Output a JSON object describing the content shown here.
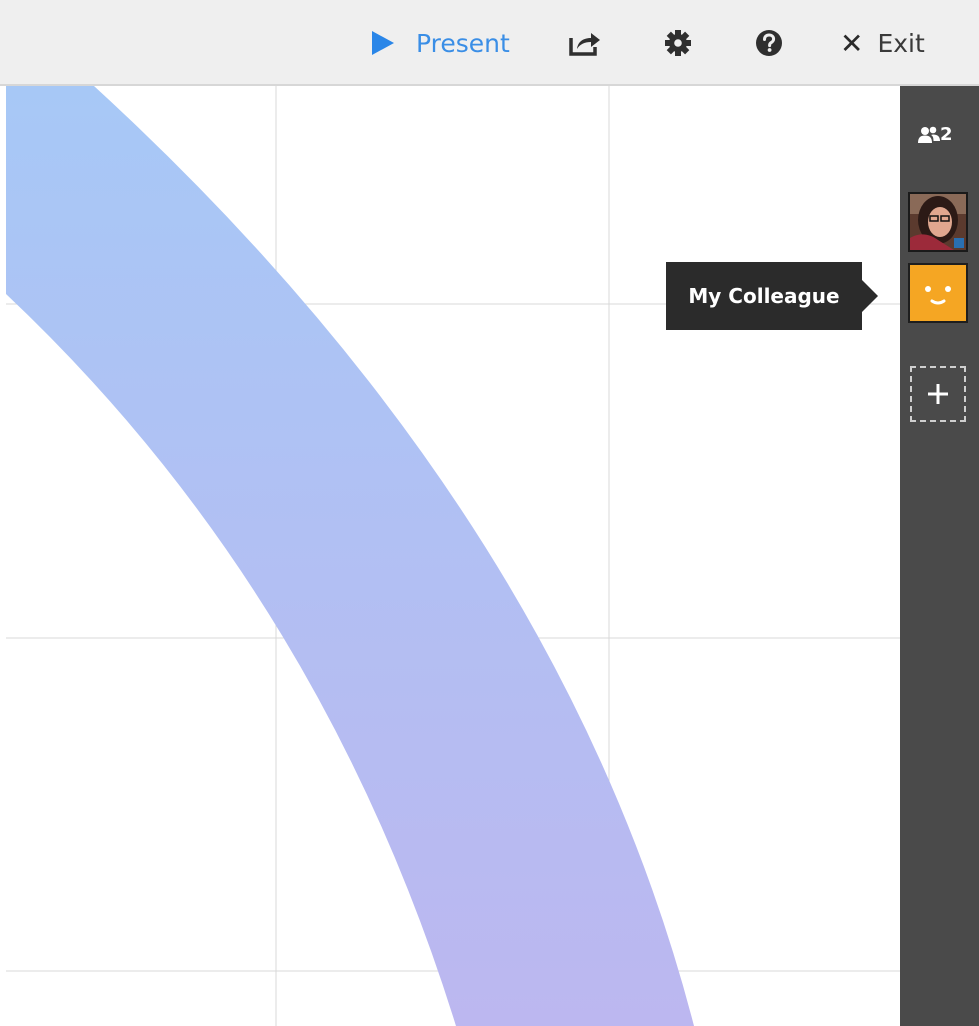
{
  "toolbar": {
    "present_label": "Present",
    "exit_label": "Exit",
    "icons": [
      "play-icon",
      "share-icon",
      "gear-icon",
      "help-icon",
      "close-icon"
    ]
  },
  "sidebar": {
    "collaborator_count": "2",
    "collaborators": [
      {
        "type": "photo",
        "badge": "in"
      },
      {
        "type": "smiley",
        "tooltip": "My Colleague"
      }
    ],
    "add_label": "+"
  },
  "tooltip": {
    "text": "My Colleague"
  },
  "colors": {
    "accent": "#2a86e8",
    "sidebar_bg": "#4a4a4a",
    "toolbar_bg": "#efefef",
    "smiley_avatar": "#f5a623",
    "tooltip_bg": "#2b2b2b",
    "arc_top": "#a7c8f6",
    "arc_bottom": "#bcb7f0",
    "grid_line": "#d9d9d9"
  }
}
